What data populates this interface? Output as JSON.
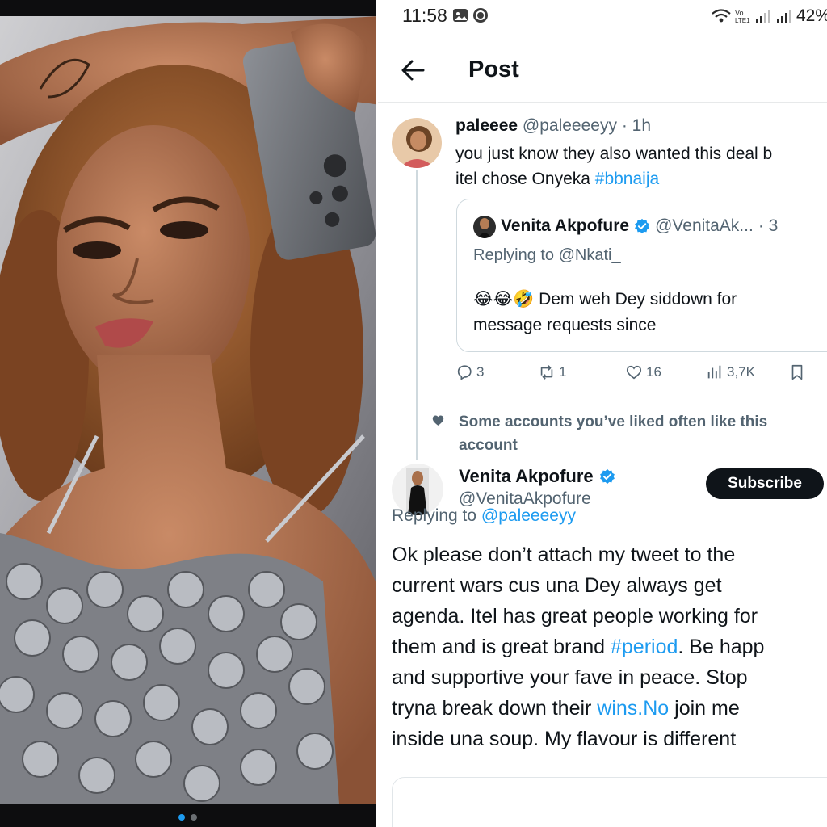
{
  "status_bar": {
    "time": "11:58",
    "battery": "42%"
  },
  "header": {
    "title": "Post"
  },
  "tweet": {
    "name": "paleeee",
    "handle": "@paleeeeyy",
    "time": "· 1h",
    "lines": [
      "you just know they also wanted this deal b",
      "itel chose Onyeka "
    ],
    "hashtag": "#bbnaija",
    "quote": {
      "name": "Venita Akpofure",
      "handle": "@VenitaAk...",
      "time": "· 3",
      "replying_to": "Replying to @Nkati_",
      "emojis": "😂😂🤣",
      "lines": [
        " Dem weh Dey siddown for",
        "message requests since"
      ]
    },
    "actions": {
      "replies": "3",
      "reposts": "1",
      "likes": "16",
      "views": "3,7K"
    }
  },
  "social_context": "Some accounts you’ve liked often like this account",
  "reply": {
    "name": "Venita Akpofure",
    "handle": "@VenitaAkpofure",
    "subscribe_label": "Subscribe",
    "replying_label": "Replying to ",
    "replying_handle": "@paleeeeyy",
    "lines": {
      "l1": "Ok please don’t attach my tweet to the",
      "l2": "current wars cus una Dey always get",
      "l3": "agenda. Itel has great people working for",
      "l4a": "them and is great brand ",
      "l4_hashtag": "#period",
      "l4b": ". Be happ",
      "l5": "and supportive your fave in peace. Stop",
      "l6a": "tryna break down their ",
      "l6_link": "wins.No",
      "l6b": " join me",
      "l7": "inside una soup. My flavour is different"
    }
  },
  "colors": {
    "accent": "#1d9bf0",
    "text": "#0f1419",
    "muted": "#536471",
    "subscribe_bg": "#0f1419"
  }
}
